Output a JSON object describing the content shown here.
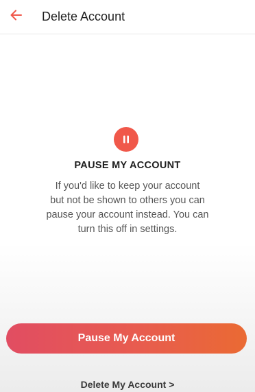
{
  "header": {
    "back_icon": "arrow-left-icon",
    "title": "Delete Account"
  },
  "colors": {
    "accent": "#f0584a",
    "button_gradient_start": "#e14d62",
    "button_gradient_end": "#ea6a33"
  },
  "pause_section": {
    "icon": "pause-icon",
    "title": "PAUSE MY ACCOUNT",
    "description_lines": [
      "If you'd like to keep your account",
      "but not be shown to others you can",
      "pause your account instead. You can",
      "turn this off in settings."
    ]
  },
  "actions": {
    "pause_button_label": "Pause My Account",
    "delete_link_label": "Delete My Account >"
  }
}
